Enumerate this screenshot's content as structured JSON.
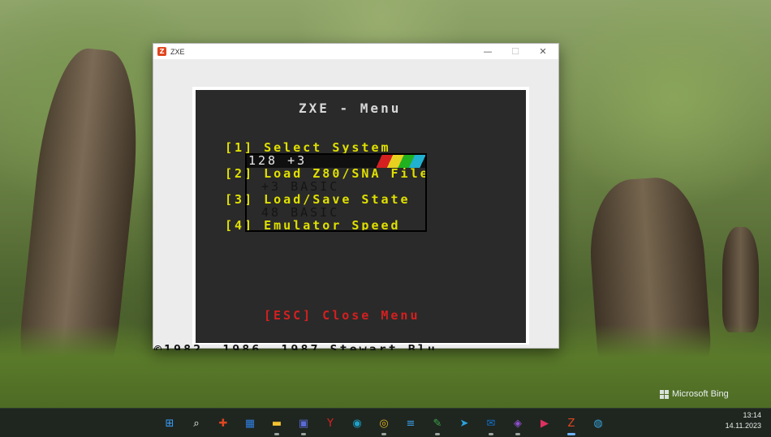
{
  "window": {
    "title": "ZXE",
    "app_icon_glyph": "Z",
    "controls": {
      "minimize": "—",
      "maximize": "☐",
      "close": "✕"
    }
  },
  "emulator_menu": {
    "title": "ZXE - Menu",
    "items": [
      "[1] Select System",
      "[2] Load Z80/SNA File",
      "[3] Load/Save State",
      "[4] Emulator Speed"
    ],
    "close_hint": "[ESC] Close Menu"
  },
  "system_submenu": {
    "selected": "128 +3",
    "options": [
      "+3 BASIC",
      "48 BASIC"
    ]
  },
  "overflow_text": "©1982, 1986, 1987 Stewart Blu",
  "wallpaper": {
    "watermark": "Microsoft Bing"
  },
  "taskbar": {
    "icons": [
      {
        "name": "start-icon",
        "glyph": "⊞",
        "color": "#3aa0ff"
      },
      {
        "name": "search-icon",
        "glyph": "⌕",
        "color": "#ffffff"
      },
      {
        "name": "tool-icon",
        "glyph": "✚",
        "color": "#e0461f"
      },
      {
        "name": "store-icon",
        "glyph": "▦",
        "color": "#2f7fe0"
      },
      {
        "name": "folder-icon",
        "glyph": "▬",
        "color": "#f2c230"
      },
      {
        "name": "save-icon",
        "glyph": "▣",
        "color": "#5a6ad8"
      },
      {
        "name": "yandex-browser-icon",
        "glyph": "Y",
        "color": "#e02020"
      },
      {
        "name": "edge-icon",
        "glyph": "◉",
        "color": "#1da1c8"
      },
      {
        "name": "chrome-icon",
        "glyph": "◎",
        "color": "#e5b323"
      },
      {
        "name": "notepad-icon",
        "glyph": "≡",
        "color": "#3b9fe8"
      },
      {
        "name": "image-editor-icon",
        "glyph": "✎",
        "color": "#3aa64a"
      },
      {
        "name": "telegram-icon",
        "glyph": "➤",
        "color": "#2aa3e0"
      },
      {
        "name": "outlook-icon",
        "glyph": "✉",
        "color": "#1170c8"
      },
      {
        "name": "visual-studio-icon",
        "glyph": "◈",
        "color": "#9050d0"
      },
      {
        "name": "media-player-icon",
        "glyph": "▶",
        "color": "#e03060"
      },
      {
        "name": "zxe-icon",
        "glyph": "Z",
        "color": "#e0461f"
      },
      {
        "name": "globe-icon",
        "glyph": "◍",
        "color": "#36a2d8"
      }
    ],
    "time": "13:14",
    "date": "14.11.2023"
  }
}
